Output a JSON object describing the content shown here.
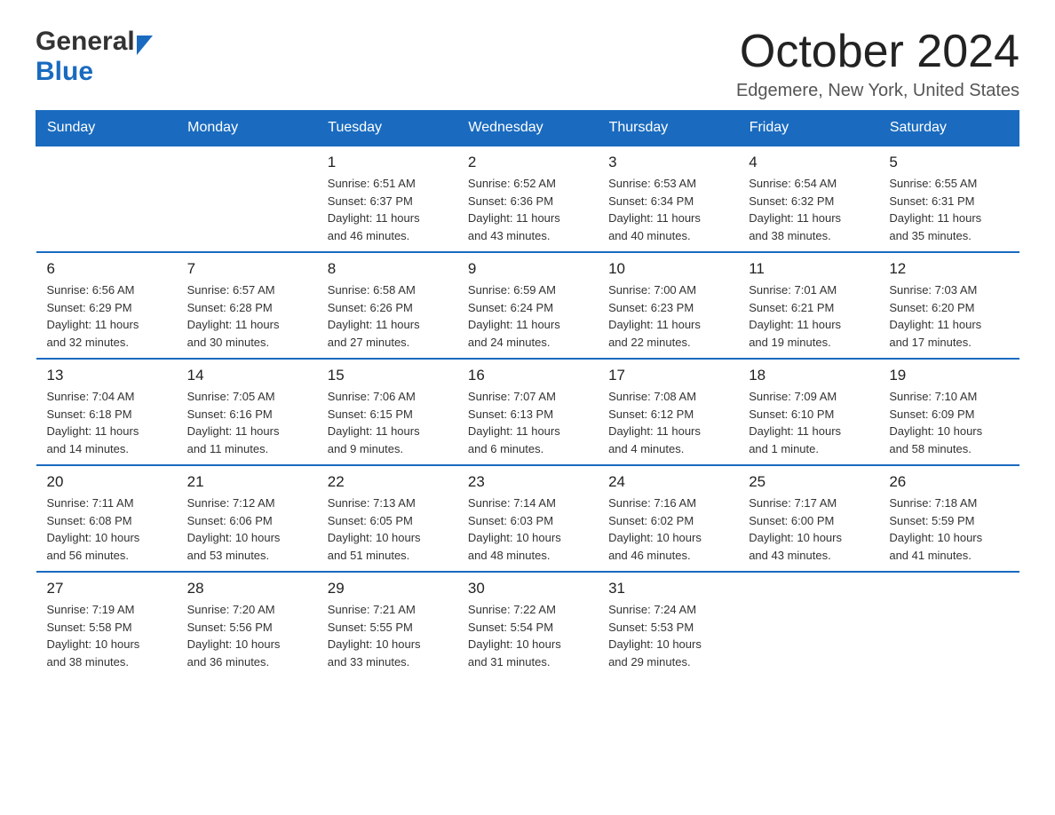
{
  "header": {
    "logo_general": "General",
    "logo_blue": "Blue",
    "title": "October 2024",
    "subtitle": "Edgemere, New York, United States"
  },
  "days_of_week": [
    "Sunday",
    "Monday",
    "Tuesday",
    "Wednesday",
    "Thursday",
    "Friday",
    "Saturday"
  ],
  "weeks": [
    [
      {
        "day": "",
        "info": ""
      },
      {
        "day": "",
        "info": ""
      },
      {
        "day": "1",
        "info": "Sunrise: 6:51 AM\nSunset: 6:37 PM\nDaylight: 11 hours\nand 46 minutes."
      },
      {
        "day": "2",
        "info": "Sunrise: 6:52 AM\nSunset: 6:36 PM\nDaylight: 11 hours\nand 43 minutes."
      },
      {
        "day": "3",
        "info": "Sunrise: 6:53 AM\nSunset: 6:34 PM\nDaylight: 11 hours\nand 40 minutes."
      },
      {
        "day": "4",
        "info": "Sunrise: 6:54 AM\nSunset: 6:32 PM\nDaylight: 11 hours\nand 38 minutes."
      },
      {
        "day": "5",
        "info": "Sunrise: 6:55 AM\nSunset: 6:31 PM\nDaylight: 11 hours\nand 35 minutes."
      }
    ],
    [
      {
        "day": "6",
        "info": "Sunrise: 6:56 AM\nSunset: 6:29 PM\nDaylight: 11 hours\nand 32 minutes."
      },
      {
        "day": "7",
        "info": "Sunrise: 6:57 AM\nSunset: 6:28 PM\nDaylight: 11 hours\nand 30 minutes."
      },
      {
        "day": "8",
        "info": "Sunrise: 6:58 AM\nSunset: 6:26 PM\nDaylight: 11 hours\nand 27 minutes."
      },
      {
        "day": "9",
        "info": "Sunrise: 6:59 AM\nSunset: 6:24 PM\nDaylight: 11 hours\nand 24 minutes."
      },
      {
        "day": "10",
        "info": "Sunrise: 7:00 AM\nSunset: 6:23 PM\nDaylight: 11 hours\nand 22 minutes."
      },
      {
        "day": "11",
        "info": "Sunrise: 7:01 AM\nSunset: 6:21 PM\nDaylight: 11 hours\nand 19 minutes."
      },
      {
        "day": "12",
        "info": "Sunrise: 7:03 AM\nSunset: 6:20 PM\nDaylight: 11 hours\nand 17 minutes."
      }
    ],
    [
      {
        "day": "13",
        "info": "Sunrise: 7:04 AM\nSunset: 6:18 PM\nDaylight: 11 hours\nand 14 minutes."
      },
      {
        "day": "14",
        "info": "Sunrise: 7:05 AM\nSunset: 6:16 PM\nDaylight: 11 hours\nand 11 minutes."
      },
      {
        "day": "15",
        "info": "Sunrise: 7:06 AM\nSunset: 6:15 PM\nDaylight: 11 hours\nand 9 minutes."
      },
      {
        "day": "16",
        "info": "Sunrise: 7:07 AM\nSunset: 6:13 PM\nDaylight: 11 hours\nand 6 minutes."
      },
      {
        "day": "17",
        "info": "Sunrise: 7:08 AM\nSunset: 6:12 PM\nDaylight: 11 hours\nand 4 minutes."
      },
      {
        "day": "18",
        "info": "Sunrise: 7:09 AM\nSunset: 6:10 PM\nDaylight: 11 hours\nand 1 minute."
      },
      {
        "day": "19",
        "info": "Sunrise: 7:10 AM\nSunset: 6:09 PM\nDaylight: 10 hours\nand 58 minutes."
      }
    ],
    [
      {
        "day": "20",
        "info": "Sunrise: 7:11 AM\nSunset: 6:08 PM\nDaylight: 10 hours\nand 56 minutes."
      },
      {
        "day": "21",
        "info": "Sunrise: 7:12 AM\nSunset: 6:06 PM\nDaylight: 10 hours\nand 53 minutes."
      },
      {
        "day": "22",
        "info": "Sunrise: 7:13 AM\nSunset: 6:05 PM\nDaylight: 10 hours\nand 51 minutes."
      },
      {
        "day": "23",
        "info": "Sunrise: 7:14 AM\nSunset: 6:03 PM\nDaylight: 10 hours\nand 48 minutes."
      },
      {
        "day": "24",
        "info": "Sunrise: 7:16 AM\nSunset: 6:02 PM\nDaylight: 10 hours\nand 46 minutes."
      },
      {
        "day": "25",
        "info": "Sunrise: 7:17 AM\nSunset: 6:00 PM\nDaylight: 10 hours\nand 43 minutes."
      },
      {
        "day": "26",
        "info": "Sunrise: 7:18 AM\nSunset: 5:59 PM\nDaylight: 10 hours\nand 41 minutes."
      }
    ],
    [
      {
        "day": "27",
        "info": "Sunrise: 7:19 AM\nSunset: 5:58 PM\nDaylight: 10 hours\nand 38 minutes."
      },
      {
        "day": "28",
        "info": "Sunrise: 7:20 AM\nSunset: 5:56 PM\nDaylight: 10 hours\nand 36 minutes."
      },
      {
        "day": "29",
        "info": "Sunrise: 7:21 AM\nSunset: 5:55 PM\nDaylight: 10 hours\nand 33 minutes."
      },
      {
        "day": "30",
        "info": "Sunrise: 7:22 AM\nSunset: 5:54 PM\nDaylight: 10 hours\nand 31 minutes."
      },
      {
        "day": "31",
        "info": "Sunrise: 7:24 AM\nSunset: 5:53 PM\nDaylight: 10 hours\nand 29 minutes."
      },
      {
        "day": "",
        "info": ""
      },
      {
        "day": "",
        "info": ""
      }
    ]
  ]
}
